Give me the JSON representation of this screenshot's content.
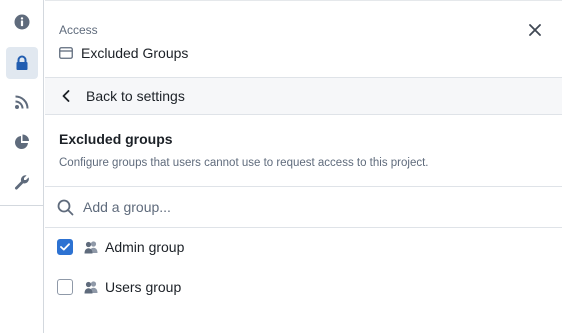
{
  "header": {
    "eyebrow": "Access",
    "title": "Excluded Groups"
  },
  "back_bar": {
    "label": "Back to settings"
  },
  "section": {
    "title": "Excluded groups",
    "description": "Configure groups that users cannot use to request access to this project."
  },
  "search": {
    "placeholder": "Add a group..."
  },
  "groups": [
    {
      "label": "Admin group",
      "checked": true
    },
    {
      "label": "Users group",
      "checked": false
    }
  ],
  "rail": {
    "icons": [
      "info-icon",
      "lock-icon",
      "rss-icon",
      "pie-chart-icon",
      "wrench-icon"
    ],
    "active": "lock-icon"
  },
  "colors": {
    "accent": "#2d72d2",
    "rail_icon": "#5f6b7c",
    "active_bg": "#e1e8f0",
    "active_icon": "#215db0"
  }
}
